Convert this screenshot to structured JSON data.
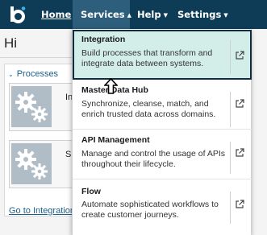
{
  "nav": {
    "logo_icon": "b-logo-icon",
    "home": "Home",
    "services": "Services",
    "help": "Help",
    "settings": "Settings"
  },
  "page": {
    "greeting": "Hi",
    "processes_header": "Processes",
    "cards": [
      {
        "title_fragment": "In",
        "icon": "gears-icon"
      },
      {
        "title_fragment": "Si",
        "icon": "gears-icon"
      }
    ],
    "go_link": "Go to Integration"
  },
  "services_menu": {
    "items": [
      {
        "title": "Integration",
        "description": "Build processes that transform and integrate data between systems.",
        "selected": true
      },
      {
        "title": "Master Data Hub",
        "description": "Synchronize, cleanse, match, and enrich trusted data across domains.",
        "selected": false
      },
      {
        "title": "API Management",
        "description": "Manage and control the usage of APIs throughout their lifecycle.",
        "selected": false
      },
      {
        "title": "Flow",
        "description": "Automate sophisticated workflows to create customer journeys.",
        "selected": false
      }
    ],
    "external_link_icon": "external-link-icon"
  },
  "colors": {
    "nav_bg": "#0e3c57",
    "nav_active": "#2d5e7c",
    "selected_bg": "#d3eee8",
    "link": "#1b5f8c"
  }
}
